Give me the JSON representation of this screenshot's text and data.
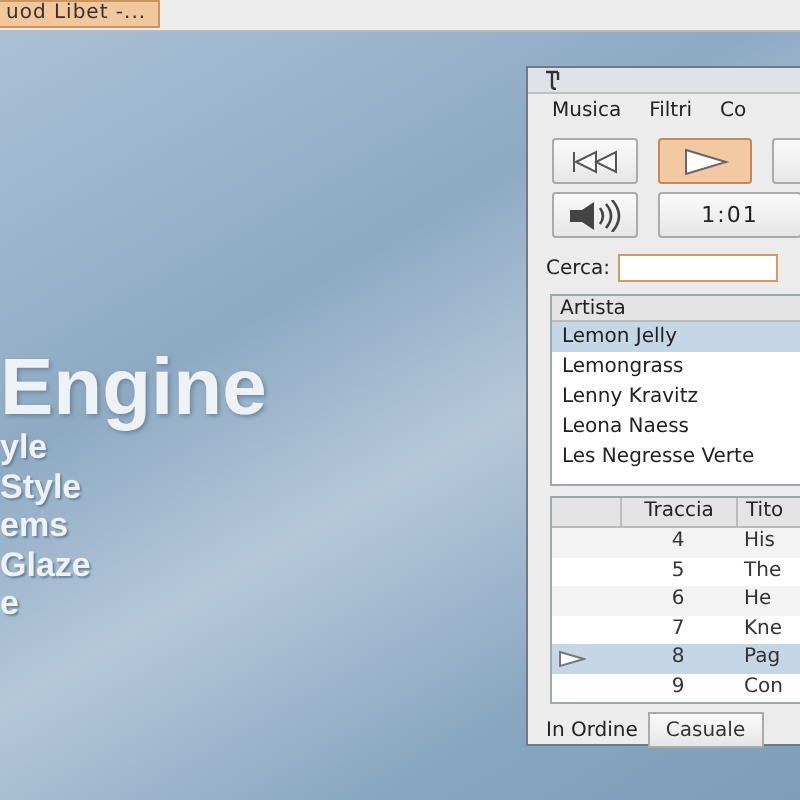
{
  "panel": {
    "taskbar_button": "uod Libet -..."
  },
  "wallpaper": {
    "title": "Engine",
    "lines": [
      "yle",
      "Style",
      "ems",
      "Glaze",
      "e"
    ]
  },
  "window": {
    "menu": [
      "Musica",
      "Filtri",
      "Co"
    ],
    "controls": [
      {
        "kind": "prev",
        "selected": false
      },
      {
        "kind": "play",
        "selected": true
      },
      {
        "kind": "next",
        "selected": false
      }
    ],
    "time": "1:01",
    "search": {
      "label": "Cerca:"
    },
    "artists": {
      "header": "Artista",
      "items": [
        {
          "name": "Lemon Jelly",
          "selected": true
        },
        {
          "name": "Lemongrass",
          "selected": false
        },
        {
          "name": "Lenny Kravitz",
          "selected": false
        },
        {
          "name": "Leona Naess",
          "selected": false
        },
        {
          "name": "Les Negresse Verte",
          "selected": false
        }
      ]
    },
    "tracks": {
      "columns": [
        "Traccia",
        "Tito"
      ],
      "rows": [
        {
          "track": "4",
          "title": "His",
          "selected": false,
          "playing": false
        },
        {
          "track": "5",
          "title": "The",
          "selected": false,
          "playing": false
        },
        {
          "track": "6",
          "title": "He",
          "selected": false,
          "playing": false
        },
        {
          "track": "7",
          "title": "Kne",
          "selected": false,
          "playing": false
        },
        {
          "track": "8",
          "title": "Pag",
          "selected": true,
          "playing": true
        },
        {
          "track": "9",
          "title": "Con",
          "selected": false,
          "playing": false
        }
      ]
    },
    "order_label": "In Ordine",
    "shuffle_button": "Casuale"
  }
}
